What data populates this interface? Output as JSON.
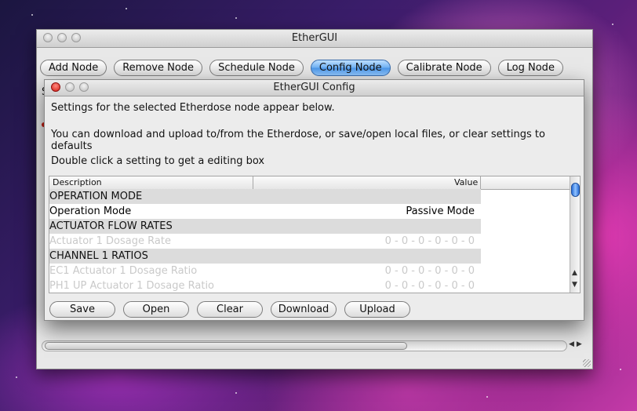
{
  "main_window": {
    "title": "EtherGUI",
    "toolbar": [
      {
        "label": "Add Node",
        "name": "add-node-button",
        "width": 86
      },
      {
        "label": "Remove Node",
        "name": "remove-node-button",
        "width": 104
      },
      {
        "label": "Schedule Node",
        "name": "schedule-node-button",
        "width": 112
      },
      {
        "label": "Config Node",
        "name": "config-node-button",
        "width": 98,
        "active": true
      },
      {
        "label": "Calibrate Node",
        "name": "calibrate-node-button",
        "width": 112
      },
      {
        "label": "Log Node",
        "name": "log-node-button",
        "width": 82
      }
    ],
    "peek_label": "S"
  },
  "dialog": {
    "title": "EtherGUI Config",
    "line1": "Settings for the selected Etherdose node appear below.",
    "line2": "You can download and upload to/from the Etherdose, or save/open local files, or clear settings to defaults",
    "line3": "Double click a setting to get a editing box",
    "table": {
      "headers": {
        "description": "Description",
        "value": "Value"
      },
      "rows": [
        {
          "type": "section",
          "description": "OPERATION MODE",
          "value": ""
        },
        {
          "type": "row",
          "description": "Operation Mode",
          "value": "Passive Mode"
        },
        {
          "type": "section",
          "description": "ACTUATOR FLOW RATES",
          "value": ""
        },
        {
          "type": "dim",
          "description": "Actuator 1 Dosage Rate",
          "value": "0 - 0 - 0 - 0 - 0 - 0"
        },
        {
          "type": "section",
          "description": "CHANNEL 1 RATIOS",
          "value": ""
        },
        {
          "type": "dim",
          "description": "EC1 Actuator 1 Dosage Ratio",
          "value": "0 - 0 - 0 - 0 - 0 - 0"
        },
        {
          "type": "dim",
          "description": "PH1 UP Actuator 1 Dosage Ratio",
          "value": "0 - 0 - 0 - 0 - 0 - 0"
        }
      ]
    },
    "buttons": [
      {
        "label": "Save",
        "name": "save-button",
        "width": 84
      },
      {
        "label": "Open",
        "name": "open-button",
        "width": 84
      },
      {
        "label": "Clear",
        "name": "clear-button",
        "width": 84
      },
      {
        "label": "Download",
        "name": "download-button",
        "width": 84
      },
      {
        "label": "Upload",
        "name": "upload-button",
        "width": 84
      }
    ]
  },
  "colors": {
    "accent": "#5aa4f0",
    "close_red": "#d41c12"
  }
}
